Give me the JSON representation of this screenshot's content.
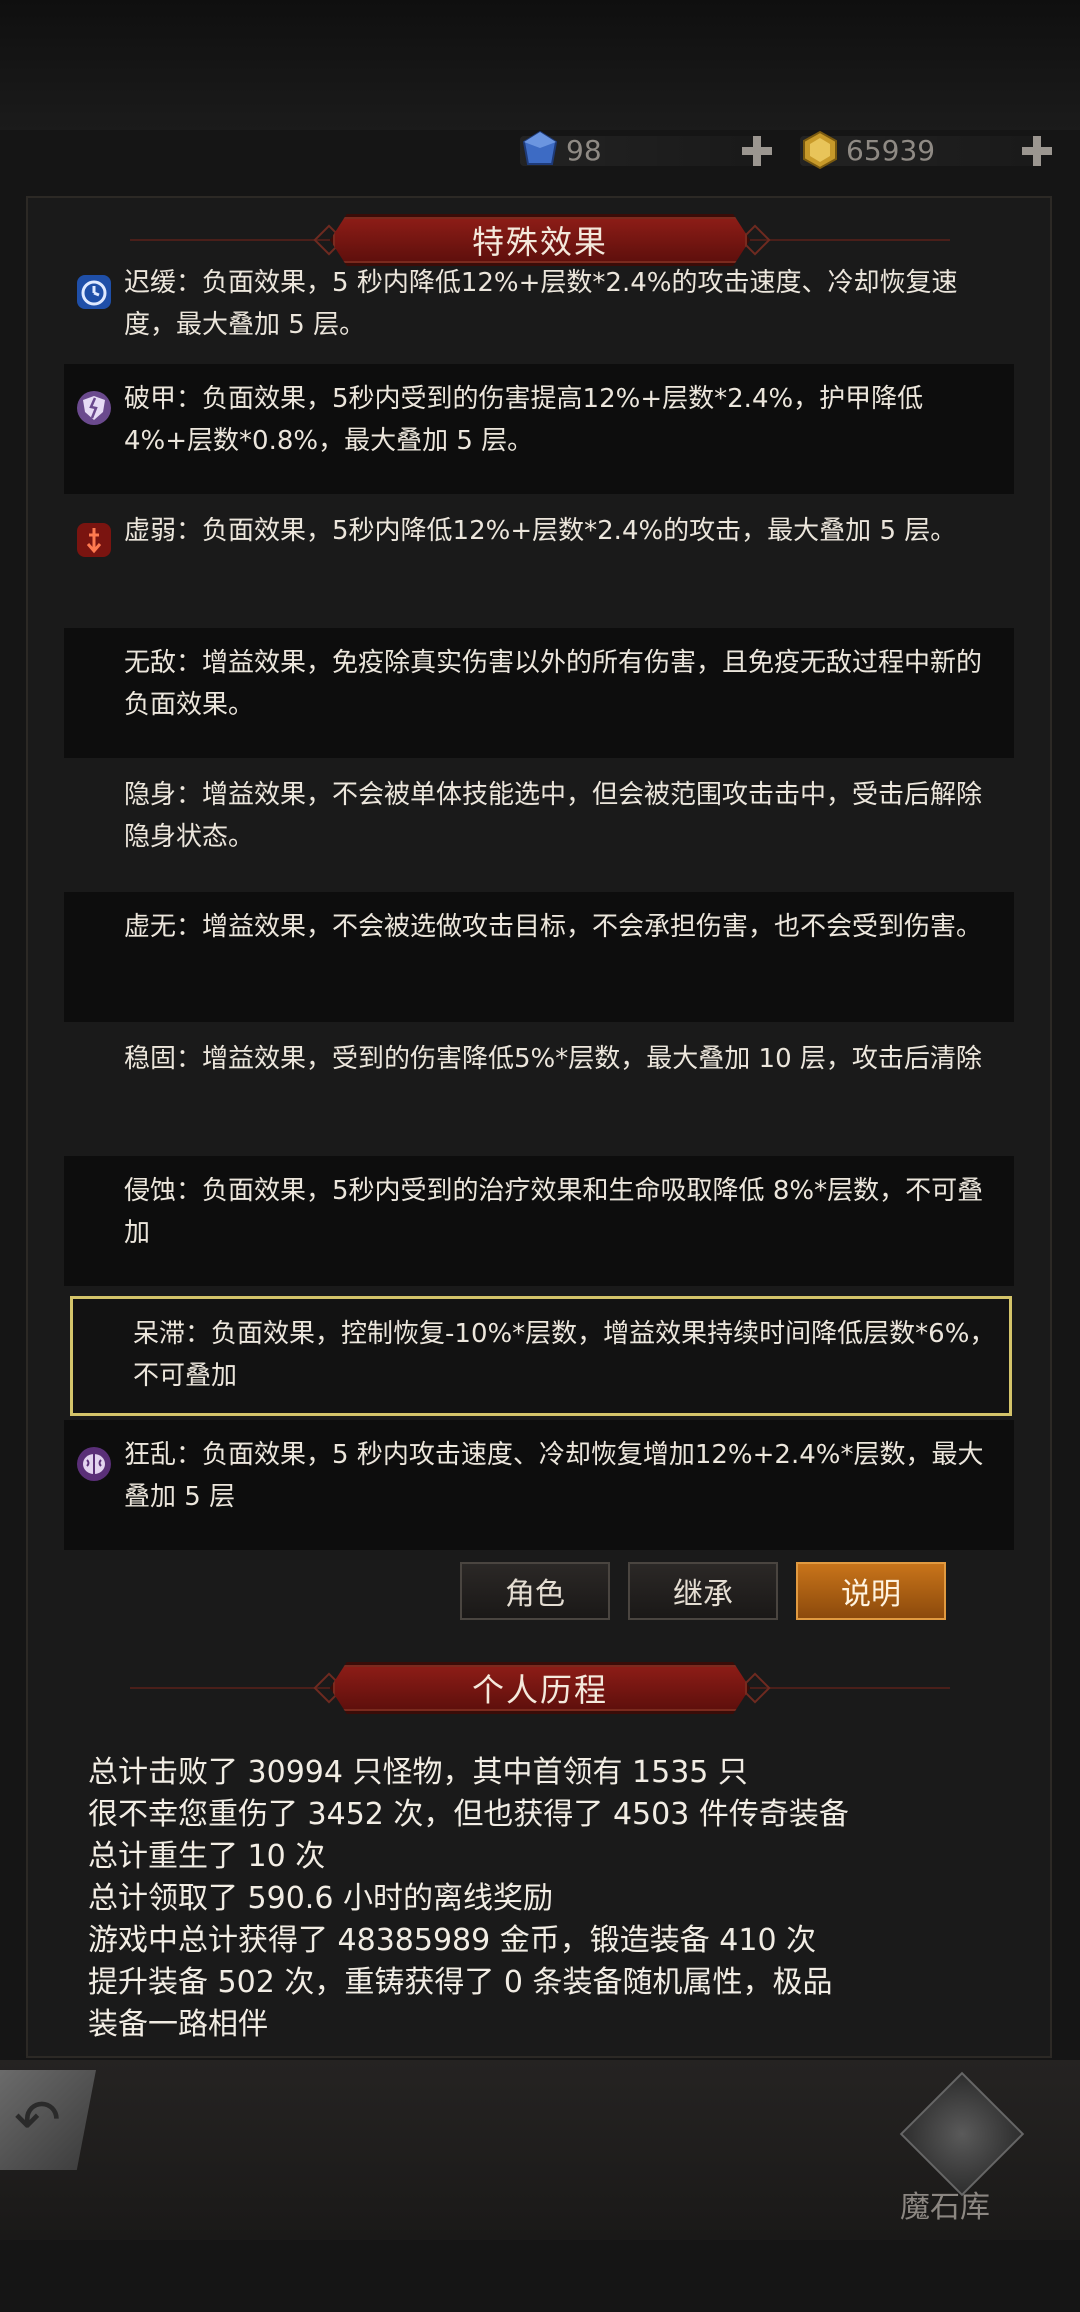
{
  "resources": {
    "gems": "98",
    "gold": "65939"
  },
  "colors": {
    "panel_bg": "#1a1a1a",
    "banner_red": "#8e1d17",
    "highlight_border": "#d4c46a",
    "active_tab": "#c8741a"
  },
  "special_effects": {
    "title": "特殊效果",
    "items": [
      {
        "name": "迟缓：",
        "desc": "负面效果，5 秒内降低12%+层数*2.4%的攻击速度、冷却恢复速度，最大叠加 5 层。",
        "icon": "clock-icon",
        "icon_color": "#2f6fd6"
      },
      {
        "name": "破甲：",
        "desc": "负面效果，5秒内受到的伤害提高12%+层数*2.4%，护甲降低4%+层数*0.8%，最大叠加 5 层。",
        "icon": "broken-shield-icon",
        "icon_color": "#9a6bc8"
      },
      {
        "name": "虚弱：",
        "desc": "负面效果，5秒内降低12%+层数*2.4%的攻击，最大叠加 5 层。",
        "icon": "weak-arrow-icon",
        "icon_color": "#c83020"
      },
      {
        "name": "无敌：",
        "desc": "增益效果，免疫除真实伤害以外的所有伤害，且免疫无敌过程中新的负面效果。",
        "icon": "",
        "icon_color": ""
      },
      {
        "name": "隐身：",
        "desc": "增益效果，不会被单体技能选中，但会被范围攻击击中，受击后解除隐身状态。",
        "icon": "",
        "icon_color": ""
      },
      {
        "name": "虚无：",
        "desc": "增益效果，不会被选做攻击目标，不会承担伤害，也不会受到伤害。",
        "icon": "",
        "icon_color": ""
      },
      {
        "name": "稳固：",
        "desc": "增益效果，受到的伤害降低5%*层数，最大叠加 10 层，攻击后清除",
        "icon": "",
        "icon_color": ""
      },
      {
        "name": "侵蚀：",
        "desc": "负面效果，5秒内受到的治疗效果和生命吸取降低 8%*层数，不可叠加",
        "icon": "",
        "icon_color": ""
      },
      {
        "name": "呆滞：",
        "desc": "负面效果，控制恢复-10%*层数，增益效果持续时间降低层数*6%，不可叠加",
        "icon": "",
        "icon_color": ""
      },
      {
        "name": "狂乱：",
        "desc": "负面效果，5 秒内攻击速度、冷却恢复增加12%+2.4%*层数，最大叠加 5 层",
        "icon": "brain-icon",
        "icon_color": "#8a4fb0"
      }
    ]
  },
  "tabs": {
    "role": "角色",
    "inherit": "继承",
    "explain": "说明"
  },
  "history": {
    "title": "个人历程",
    "lines": [
      "总计击败了 30994 只怪物，其中首领有 1535 只",
      "很不幸您重伤了 3452 次，但也获得了 4503 件传奇装备",
      "总计重生了 10 次",
      "总计领取了 590.6 小时的离线奖励",
      "游戏中总计获得了 48385989 金币，锻造装备 410 次",
      "提升装备 502 次，重铸获得了 0 条装备随机属性，极品",
      "装备一路相伴"
    ]
  },
  "bottom": {
    "vault_label": "魔石库"
  }
}
